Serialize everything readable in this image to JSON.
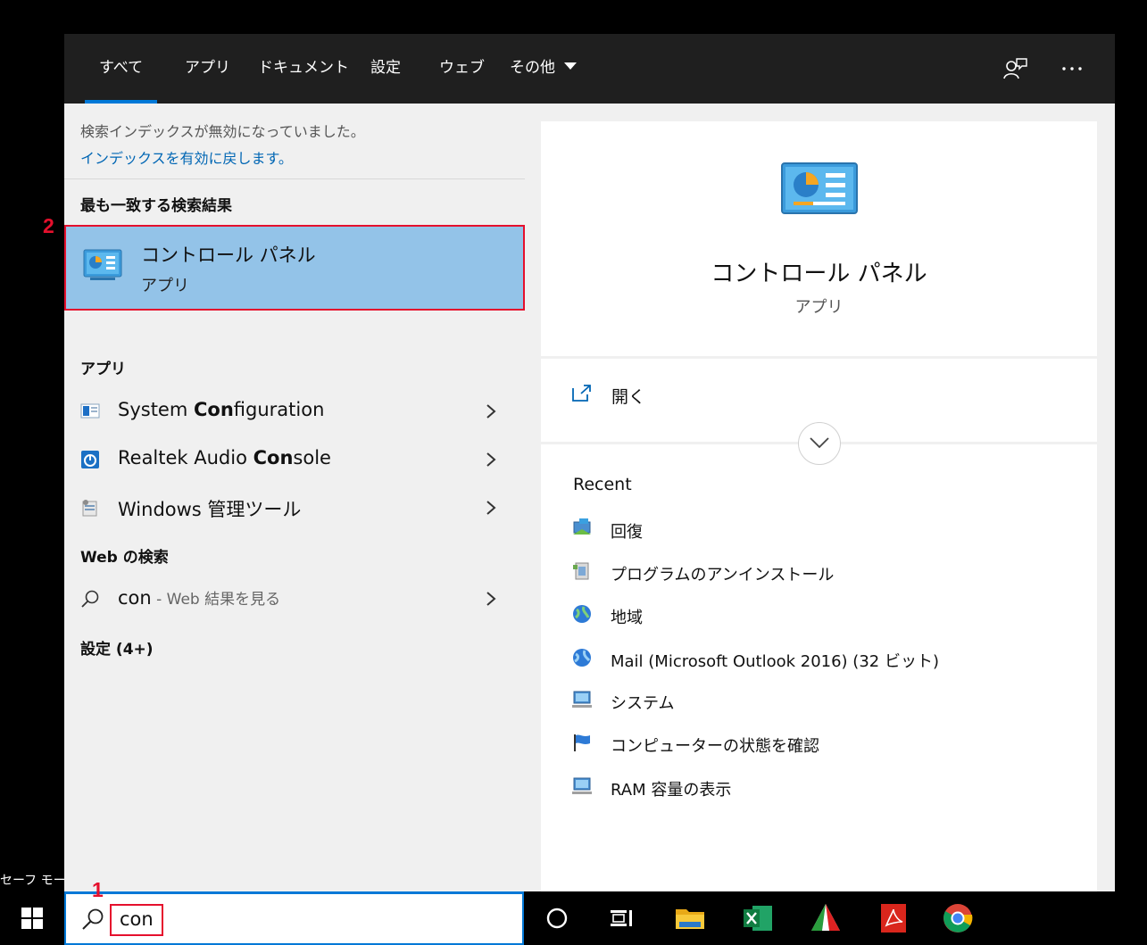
{
  "desktop": {
    "safe_mode_text": "セーフ モー"
  },
  "tabs": [
    {
      "label": "すべて",
      "active": true
    },
    {
      "label": "アプリ"
    },
    {
      "label": "ドキュメント"
    },
    {
      "label": "設定"
    },
    {
      "label": "ウェブ"
    },
    {
      "label": "その他",
      "has_dropdown": true
    }
  ],
  "top_icons": [
    "feedback-icon",
    "more-options-icon"
  ],
  "notice": {
    "message": "検索インデックスが無効になっていました。",
    "link": "インデックスを有効に戻します。"
  },
  "best_match": {
    "section_title": "最も一致する検索結果",
    "name": "コントロール パネル",
    "type": "アプリ",
    "icon": "control-panel-icon"
  },
  "apps": {
    "section_title": "アプリ",
    "items": [
      {
        "pre": "System ",
        "match": "Con",
        "post": "figuration",
        "icon": "system-configuration-icon"
      },
      {
        "pre": "Realtek Audio ",
        "match": "Con",
        "post": "sole",
        "icon": "realtek-audio-icon"
      },
      {
        "pre": "Windows 管理ツール",
        "match": "",
        "post": "",
        "icon": "admin-tools-icon"
      }
    ]
  },
  "web": {
    "section_title": "Web の検索",
    "query": "con",
    "suffix": " - Web 結果を見る"
  },
  "settings": {
    "section_title": "設定 (4+)"
  },
  "preview": {
    "name": "コントロール パネル",
    "type": "アプリ",
    "open_label": "開く",
    "recent_title": "Recent",
    "recent_items": [
      {
        "label": "回復",
        "icon": "recovery-icon"
      },
      {
        "label": "プログラムのアンインストール",
        "icon": "uninstall-icon"
      },
      {
        "label": "地域",
        "icon": "region-icon"
      },
      {
        "label": "Mail (Microsoft Outlook 2016) (32 ビット)",
        "icon": "mail-icon"
      },
      {
        "label": "システム",
        "icon": "system-icon"
      },
      {
        "label": "コンピューターの状態を確認",
        "icon": "security-flag-icon"
      },
      {
        "label": "RAM 容量の表示",
        "icon": "system-icon"
      }
    ]
  },
  "taskbar": {
    "search_value": "con",
    "apps": [
      "cortana-icon",
      "task-view-icon",
      "file-explorer-icon",
      "excel-icon",
      "app-icon",
      "acrobat-icon",
      "chrome-icon"
    ]
  },
  "callouts": {
    "step1": "1",
    "step2": "2"
  },
  "colors": {
    "accent": "#0078d7",
    "highlight": "#93c3e8",
    "callout": "#e5102d",
    "topbar": "#1f1f1f"
  }
}
